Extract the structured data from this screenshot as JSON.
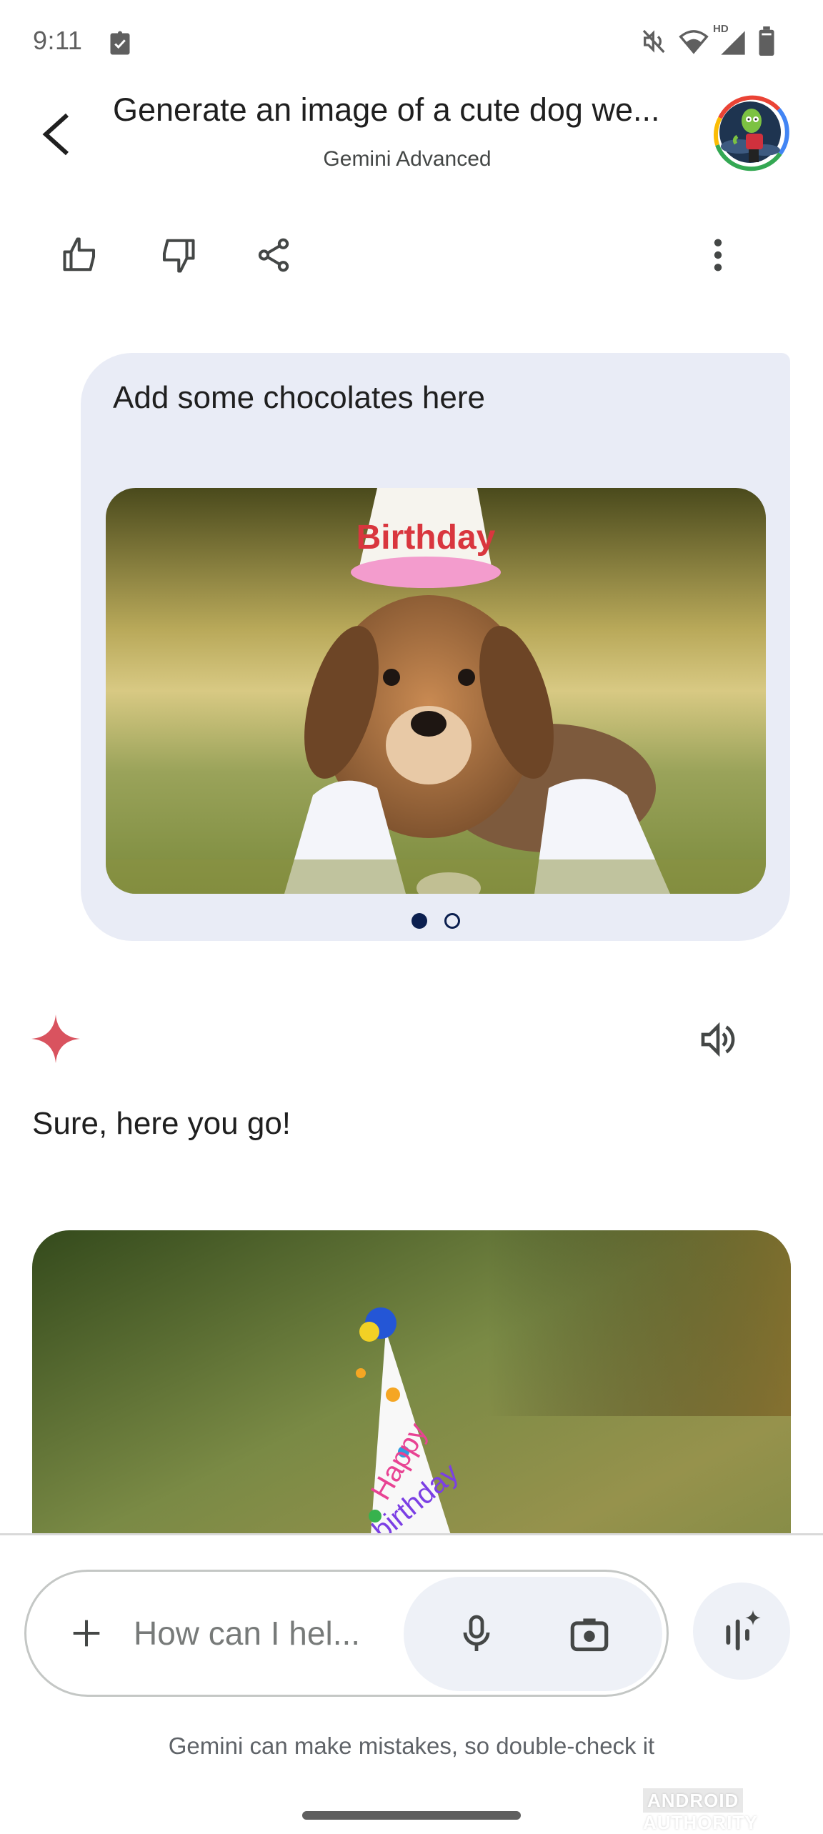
{
  "status_bar": {
    "time": "9:11",
    "left_icons": [
      "clipboard-check-icon"
    ],
    "right_icons": [
      "mute-icon",
      "wifi-icon",
      "signal-hd-icon",
      "battery-icon"
    ],
    "signal_label": "HD"
  },
  "header": {
    "title": "Generate an image of a cute dog we...",
    "subtitle": "Gemini Advanced",
    "back_icon": "back-arrow-icon",
    "avatar_ring_colors": [
      "#ea4335",
      "#4285f4",
      "#34a853",
      "#fbbc05"
    ]
  },
  "action_row": {
    "buttons": [
      "thumbs-up-icon",
      "thumbs-down-icon",
      "share-icon"
    ],
    "more_icon": "more-vert-icon"
  },
  "user_message": {
    "text": "Add some chocolates here",
    "image_alt": "Puppy wearing a Happy Birthday party hat lying between white sneakers on grass",
    "hat_text": "Birthday",
    "carousel": {
      "count": 2,
      "active_index": 0
    },
    "bubble_color": "#e9ecf6",
    "dot_color": "#0b1f4f"
  },
  "response": {
    "icon": "gemini-sparkle-icon",
    "sparkle_color": "#d9535f",
    "listen_icon": "speaker-icon",
    "text": "Sure, here you go!",
    "image_alt": "Puppy wearing a Happy Birthday party hat against a blurred green background",
    "hat_text_line1": "Happy",
    "hat_text_line2": "birthday"
  },
  "composer": {
    "placeholder": "How can I hel...",
    "value": "",
    "add_icon": "plus-icon",
    "mic_icon": "mic-icon",
    "camera_icon": "camera-icon",
    "live_icon": "gemini-live-icon"
  },
  "footer": {
    "disclaimer": "Gemini can make mistakes, so double-check it",
    "watermark_part1": "ANDROID",
    "watermark_part2": "AUTHORITY"
  }
}
